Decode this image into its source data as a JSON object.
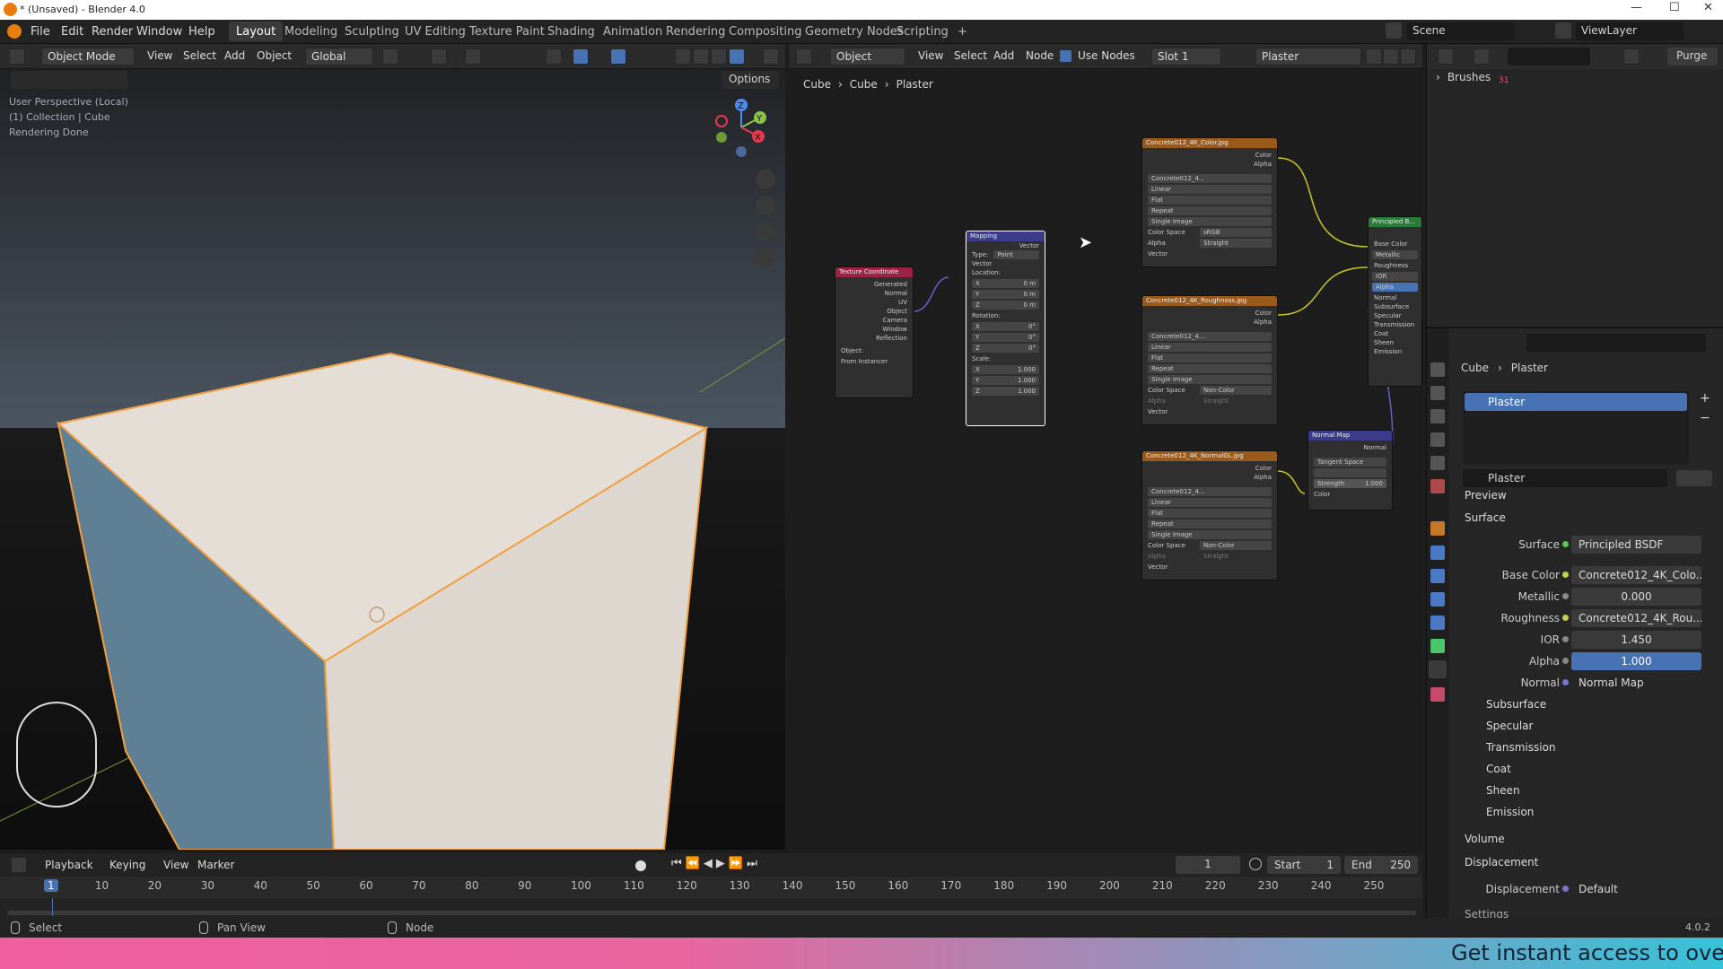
{
  "window": {
    "title": "* (Unsaved) - Blender 4.0",
    "min": "—",
    "max": "☐",
    "close": "✕"
  },
  "menu": [
    "File",
    "Edit",
    "Render",
    "Window",
    "Help"
  ],
  "workspaces": [
    "Layout",
    "Modeling",
    "Sculpting",
    "UV Editing",
    "Texture Paint",
    "Shading",
    "Animation",
    "Rendering",
    "Compositing",
    "Geometry Nodes",
    "Scripting",
    "+"
  ],
  "top_right": {
    "scene": "Scene",
    "viewlayer": "ViewLayer"
  },
  "viewport": {
    "mode": "Object Mode",
    "menus": [
      "View",
      "Select",
      "Add",
      "Object"
    ],
    "orientation": "Global",
    "options": "Options",
    "info": [
      "User Perspective (Local)",
      "(1) Collection | Cube",
      "Rendering Done"
    ],
    "gizmo": {
      "z": "Z",
      "y": "Y",
      "x": "X"
    }
  },
  "node_editor": {
    "editor_type": "Object",
    "menus": [
      "View",
      "Select",
      "Add",
      "Node"
    ],
    "use_nodes": "Use Nodes",
    "slot": "Slot 1",
    "material": "Plaster",
    "breadcrumb": [
      "Cube",
      "Cube",
      "Plaster"
    ],
    "nodes": {
      "texcoord": {
        "title": "Texture Coordinate",
        "outputs": [
          "Generated",
          "Normal",
          "UV",
          "Object",
          "Camera",
          "Window",
          "Reflection"
        ],
        "object": "Object:",
        "instancer": "From Instancer"
      },
      "mapping": {
        "title": "Mapping",
        "vector_out": "Vector",
        "type_label": "Type:",
        "type": "Point",
        "vector_in": "Vector",
        "location": "Location:",
        "loc": [
          "X",
          "0 m",
          "Y",
          "0 m",
          "Z",
          "0 m"
        ],
        "rotation": "Rotation:",
        "rot": [
          "X",
          "0°",
          "Y",
          "0°",
          "Z",
          "0°"
        ],
        "scale": "Scale:",
        "sca": [
          "X",
          "1.000",
          "Y",
          "1.000",
          "Z",
          "1.000"
        ]
      },
      "color": {
        "title": "Concrete012_4K_Color.jpg",
        "out": [
          "Color",
          "Alpha"
        ],
        "img": "Concrete012_4...",
        "fields": [
          "Linear",
          "Flat",
          "Repeat",
          "Single Image"
        ],
        "cs_label": "Color Space",
        "cs": "sRGB",
        "alpha_label": "Alpha",
        "alpha": "Straight",
        "vector": "Vector"
      },
      "rough": {
        "title": "Concrete012_4K_Roughness.jpg",
        "out": [
          "Color",
          "Alpha"
        ],
        "img": "Concrete012_4...",
        "fields": [
          "Linear",
          "Flat",
          "Repeat",
          "Single Image"
        ],
        "cs_label": "Color Space",
        "cs": "Non-Color",
        "alpha_label": "Alpha",
        "alpha": "Straight",
        "vector": "Vector"
      },
      "normal": {
        "title": "Concrete012_4K_NormalGL.jpg",
        "out": [
          "Color",
          "Alpha"
        ],
        "img": "Concrete012_4...",
        "fields": [
          "Linear",
          "Flat",
          "Repeat",
          "Single Image"
        ],
        "cs_label": "Color Space",
        "cs": "Non-Color",
        "alpha_label": "Alpha",
        "alpha": "Straight",
        "vector": "Vector"
      },
      "normalmap": {
        "title": "Normal Map",
        "out": "Normal",
        "space": "Tangent Space",
        "strength_label": "Strength",
        "strength": "1.000",
        "color": "Color"
      },
      "bsdf": {
        "title": "Principled B...",
        "rows": [
          "Base Color",
          "Metallic",
          "Roughness",
          "IOR",
          "Alpha",
          "Normal",
          "Subsurface",
          "Specular",
          "Transmission",
          "Coat",
          "Sheen",
          "Emission"
        ]
      }
    }
  },
  "outliner": {
    "brushes": "Brushes",
    "count": "31",
    "purge": "Purge"
  },
  "properties": {
    "breadcrumb": [
      "Cube",
      "Plaster"
    ],
    "slot": "Plaster",
    "material": "Plaster",
    "sections": {
      "preview": "Preview",
      "surface": "Surface",
      "volume": "Volume",
      "displacement": "Displacement",
      "settings": "Settings"
    },
    "surface": {
      "label": "Surface",
      "value": "Principled BSDF"
    },
    "rows": [
      {
        "label": "Base Color",
        "value": "Concrete012_4K_Colo..."
      },
      {
        "label": "Metallic",
        "value": "0.000"
      },
      {
        "label": "Roughness",
        "value": "Concrete012_4K_Rou..."
      },
      {
        "label": "IOR",
        "value": "1.450"
      },
      {
        "label": "Alpha",
        "value": "1.000"
      },
      {
        "label": "Normal",
        "value": "Normal Map"
      }
    ],
    "subpanels": [
      "Subsurface",
      "Specular",
      "Transmission",
      "Coat",
      "Sheen",
      "Emission"
    ],
    "disp": {
      "label": "Displacement",
      "value": "Default"
    }
  },
  "timeline": {
    "menus": [
      "Playback",
      "Keying",
      "View",
      "Marker"
    ],
    "frame": "1",
    "start_label": "Start",
    "start": "1",
    "end_label": "End",
    "end": "250",
    "ticks": [
      "1",
      "10",
      "20",
      "30",
      "40",
      "50",
      "60",
      "70",
      "80",
      "90",
      "100",
      "110",
      "120",
      "130",
      "140",
      "150",
      "160",
      "170",
      "180",
      "190",
      "200",
      "210",
      "220",
      "230",
      "240",
      "250"
    ]
  },
  "status": {
    "select": "Select",
    "pan": "Pan View",
    "node": "Node",
    "version": "4.0.2"
  },
  "banner": "Get instant access to over"
}
